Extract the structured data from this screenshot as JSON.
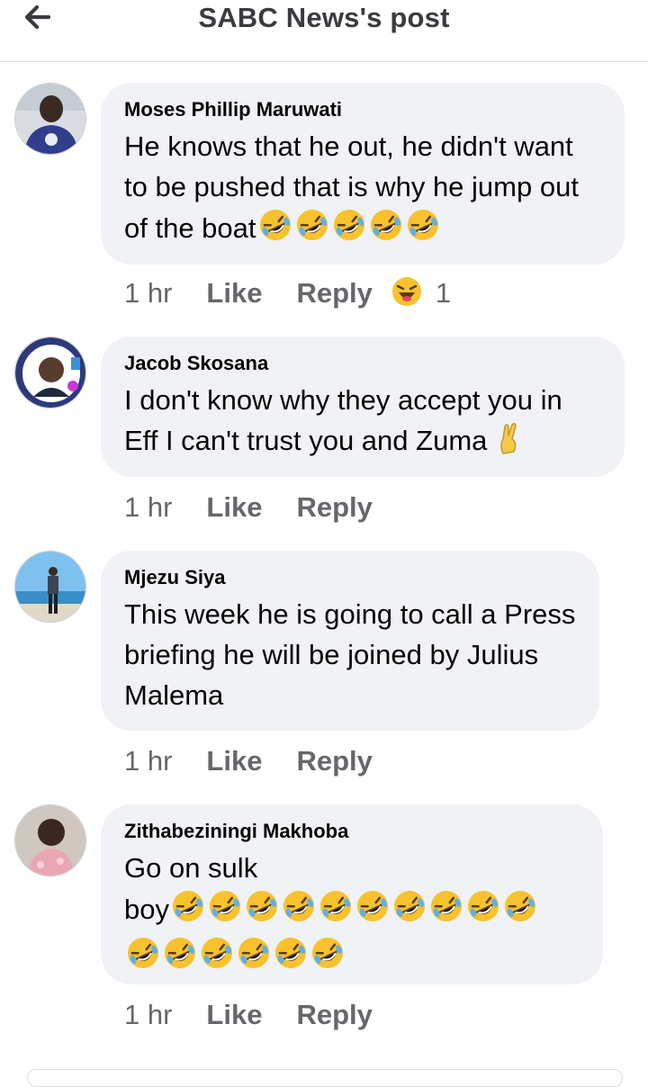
{
  "header": {
    "title": "SABC News's post",
    "back_icon": "arrow-left-icon"
  },
  "comments": [
    {
      "author": "Moses Phillip Maruwati",
      "text": "He knows that he out, he didn't want to be pushed that is why he jump out of the boat",
      "emoji": "rolling-on-floor-laughing-icon",
      "emoji_count": 5,
      "time": "1 hr",
      "like": "Like",
      "reply": "Reply",
      "reaction": "laughing-face-icon",
      "reaction_count": "1"
    },
    {
      "author": "Jacob Skosana",
      "text": "I don't know why they accept you in Eff I can't trust you and Zuma",
      "emoji": "crossed-fingers-icon",
      "time": "1 hr",
      "like": "Like",
      "reply": "Reply"
    },
    {
      "author": "Mjezu Siya",
      "text": "This week he is going to call a Press briefing he will be joined by Julius Malema",
      "time": "1 hr",
      "like": "Like",
      "reply": "Reply"
    },
    {
      "author": "Zithabeziningi Makhoba",
      "text_line1": "Go on sulk",
      "text_line2": "boy",
      "emoji": "rolling-on-floor-laughing-icon",
      "emoji_count": 16,
      "time": "1 hr",
      "like": "Like",
      "reply": "Reply"
    }
  ],
  "colors": {
    "bubble": "#f0f2f5",
    "meta": "#65676b",
    "text": "#050505",
    "title": "#3a3b3f"
  }
}
